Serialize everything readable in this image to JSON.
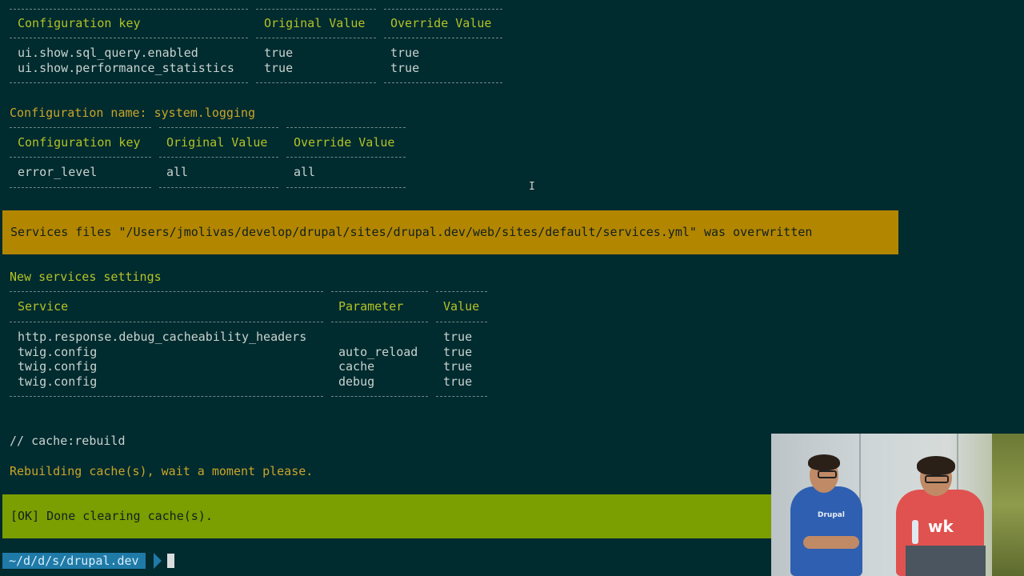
{
  "table1": {
    "headers": [
      "Configuration key",
      "Original Value",
      "Override Value"
    ],
    "rows": [
      [
        "ui.show.sql_query.enabled",
        "true",
        "true"
      ],
      [
        "ui.show.performance_statistics",
        "true",
        "true"
      ]
    ]
  },
  "config_name": {
    "label": "Configuration name:",
    "value": "system.logging"
  },
  "table2": {
    "headers": [
      "Configuration key",
      "Original Value",
      "Override Value"
    ],
    "rows": [
      [
        "error_level",
        "all",
        "all"
      ]
    ]
  },
  "warning_banner": {
    "text": "Services files \"/Users/jmolivas/develop/drupal/sites/drupal.dev/web/sites/default/services.yml\" was overwritten",
    "color": "#b38600"
  },
  "services_title": "New services settings",
  "table3": {
    "headers": [
      "Service",
      "Parameter",
      "Value"
    ],
    "rows": [
      [
        "http.response.debug_cacheability_headers",
        "",
        "true"
      ],
      [
        "twig.config",
        "auto_reload",
        "true"
      ],
      [
        "twig.config",
        "cache",
        "true"
      ],
      [
        "twig.config",
        "debug",
        "true"
      ]
    ]
  },
  "command_comment": "// cache:rebuild",
  "rebuild_message": "Rebuilding cache(s), wait a moment please.",
  "ok_banner": {
    "text": "[OK] Done clearing cache(s).",
    "color": "#7b9e00"
  },
  "prompt": {
    "path": "~/d/d/s/drupal.dev",
    "color": "#1f7aa8"
  },
  "webcam": {
    "shirt_text_left": "Drupal",
    "shirt_text_right": "wk"
  },
  "icons": {
    "ibeam": "text-cursor-icon"
  }
}
